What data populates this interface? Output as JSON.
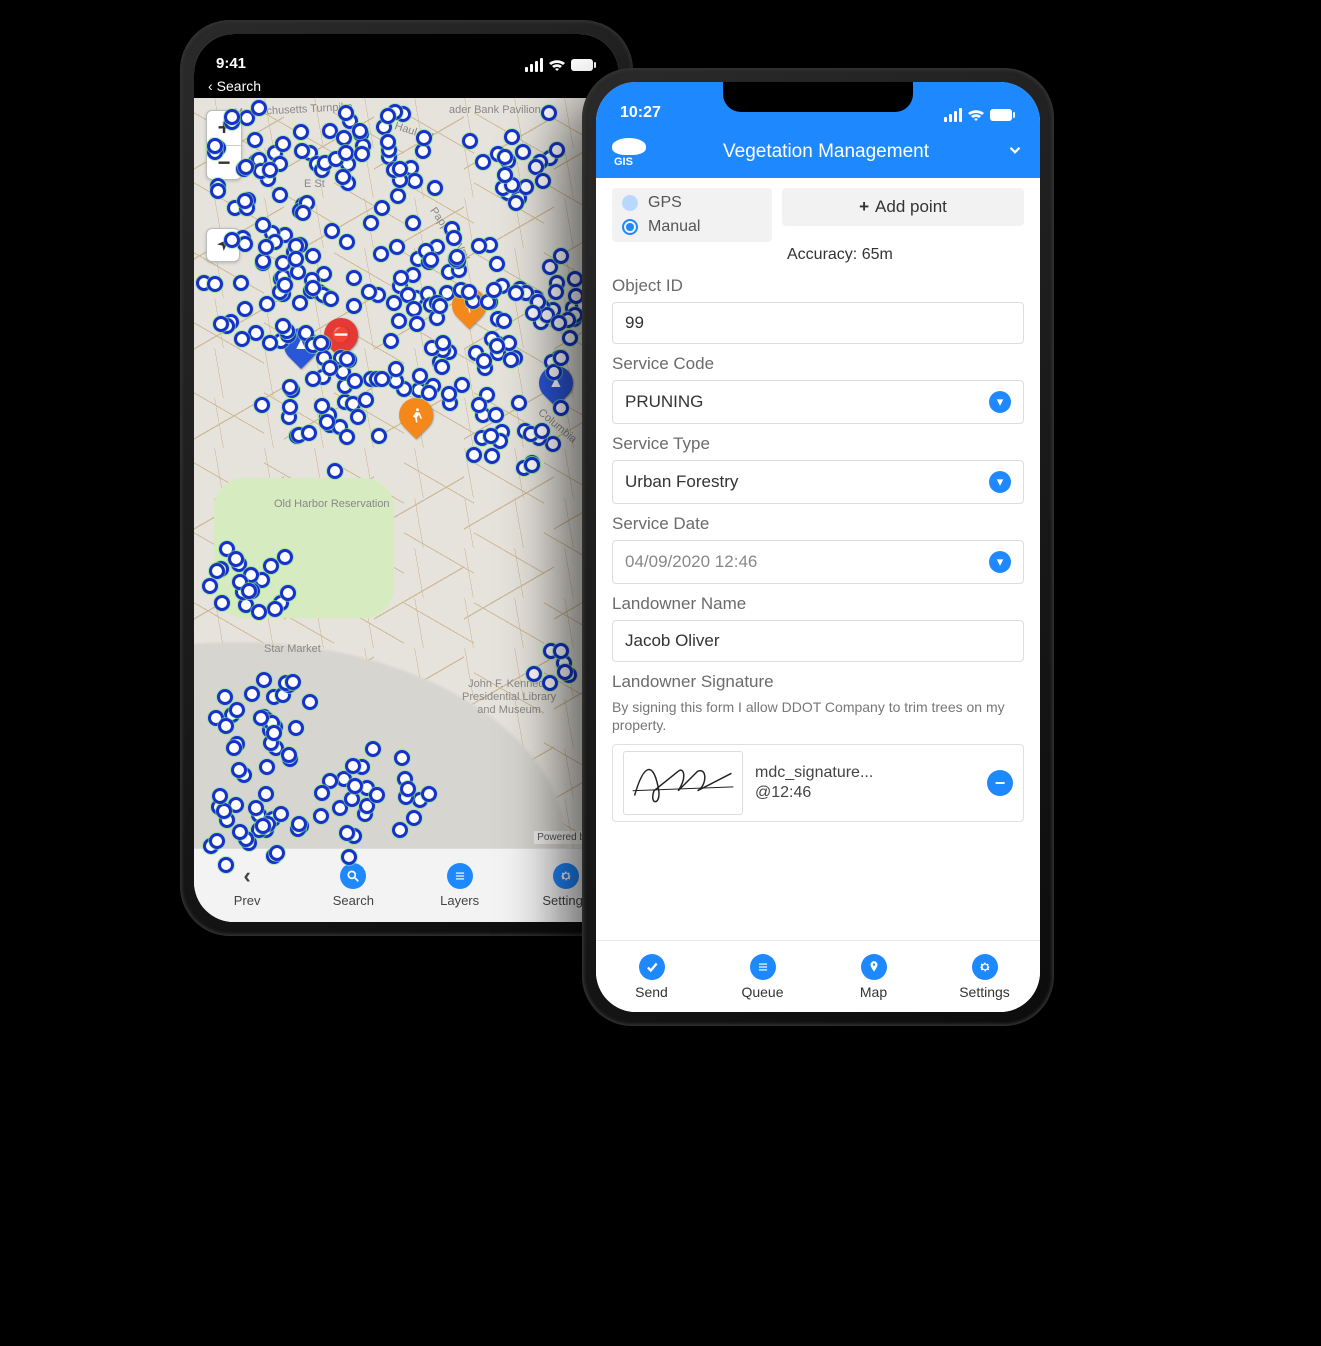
{
  "phone1": {
    "status": {
      "time": "9:41"
    },
    "back": {
      "label": "Search"
    },
    "map": {
      "attribution": "Powered by GIS",
      "labels": {
        "turnpike": "Massachusetts Turnpike",
        "bank": "ader Bank Pavilion",
        "haul": "Haul Rd",
        "est": "E St",
        "pappas": "Pappas Way",
        "columbia": "Columbia",
        "oldharbor": "Old Harbor Reservation",
        "starmarket": "Star Market",
        "jfk": "John F. Kennedy\nPresidential Library\nand Museum"
      }
    },
    "tabs": {
      "prev": "Prev",
      "search": "Search",
      "layers": "Layers",
      "settings": "Settings"
    }
  },
  "phone2": {
    "status": {
      "time": "10:27"
    },
    "header": {
      "title": "Vegetation Management"
    },
    "mode": {
      "gps": "GPS",
      "manual": "Manual",
      "selected": "Manual"
    },
    "addpoint": "Add point",
    "accuracy_label": "Accuracy: 65m",
    "fields": {
      "object_id": {
        "label": "Object ID",
        "value": "99"
      },
      "service_code": {
        "label": "Service Code",
        "value": "PRUNING"
      },
      "service_type": {
        "label": "Service Type",
        "value": "Urban Forestry"
      },
      "service_date": {
        "label": "Service Date",
        "value": "04/09/2020 12:46"
      },
      "landowner": {
        "label": "Landowner Name",
        "value": "Jacob Oliver"
      },
      "signature": {
        "label": "Landowner Signature",
        "help": "By signing this form I allow DDOT Company to trim trees on my property.",
        "file": "mdc_signature...",
        "time": "@12:46"
      }
    },
    "tabs": {
      "send": "Send",
      "queue": "Queue",
      "map": "Map",
      "settings": "Settings"
    }
  }
}
